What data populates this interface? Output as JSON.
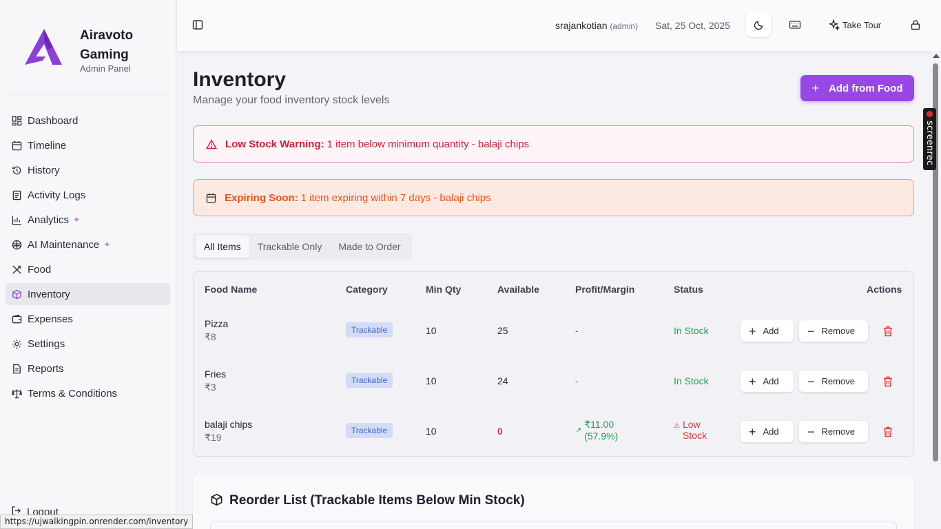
{
  "sidebar": {
    "brand_name": "Airavoto Gaming",
    "brand_sub": "Admin Panel",
    "items": [
      {
        "label": "Dashboard",
        "icon": "dashboard-icon"
      },
      {
        "label": "Timeline",
        "icon": "calendar-icon"
      },
      {
        "label": "History",
        "icon": "history-icon"
      },
      {
        "label": "Activity Logs",
        "icon": "logs-icon"
      },
      {
        "label": "Analytics",
        "icon": "chart-icon",
        "sparkle": true
      },
      {
        "label": "AI Maintenance",
        "icon": "ai-icon",
        "sparkle": true
      },
      {
        "label": "Food",
        "icon": "utensils-icon"
      },
      {
        "label": "Inventory",
        "icon": "package-icon",
        "active": true
      },
      {
        "label": "Expenses",
        "icon": "wallet-icon"
      },
      {
        "label": "Settings",
        "icon": "gear-icon"
      },
      {
        "label": "Reports",
        "icon": "report-icon"
      },
      {
        "label": "Terms & Conditions",
        "icon": "scale-icon"
      }
    ],
    "logout": "Logout",
    "status_url": "https://ujwalkingpin.onrender.com/inventory"
  },
  "topbar": {
    "username": "srajankotian",
    "role": "(admin)",
    "date": "Sat, 25 Oct, 2025",
    "tour_label": "Take Tour"
  },
  "main": {
    "title": "Inventory",
    "subtitle": "Manage your food inventory stock levels",
    "add_button": "Add from Food",
    "low_stock_title": "Low Stock Warning:",
    "low_stock_text": "1 item below minimum quantity - balaji chips",
    "expiring_title": "Expiring Soon:",
    "expiring_text": "1 item expiring within 7 days - balaji chips",
    "tabs": [
      "All Items",
      "Trackable Only",
      "Made to Order"
    ],
    "columns": [
      "Food Name",
      "Category",
      "Min Qty",
      "Available",
      "Profit/Margin",
      "Status",
      "Actions"
    ],
    "rows": [
      {
        "name": "Pizza",
        "price": "₹8",
        "category": "Trackable",
        "min_qty": "10",
        "available": "25",
        "profit": "-",
        "status": "In Stock"
      },
      {
        "name": "Fries",
        "price": "₹3",
        "category": "Trackable",
        "min_qty": "10",
        "available": "24",
        "profit": "-",
        "status": "In Stock"
      },
      {
        "name": "balaji chips",
        "price": "₹19",
        "category": "Trackable",
        "min_qty": "10",
        "available": "0",
        "profit": "₹11.00",
        "margin": "(57.9%)",
        "status_line1": "Low",
        "status_line2": "Stock"
      }
    ],
    "add_label": "Add",
    "remove_label": "Remove",
    "reorder_title": "Reorder List (Trackable Items Below Min Stock)"
  },
  "overlay": {
    "recorder_label": "screenrec"
  },
  "colors": {
    "accent": "#9747e6",
    "danger": "#d32035",
    "warning": "#e6541a",
    "success": "#22a04e",
    "badge": "#3866d6"
  }
}
